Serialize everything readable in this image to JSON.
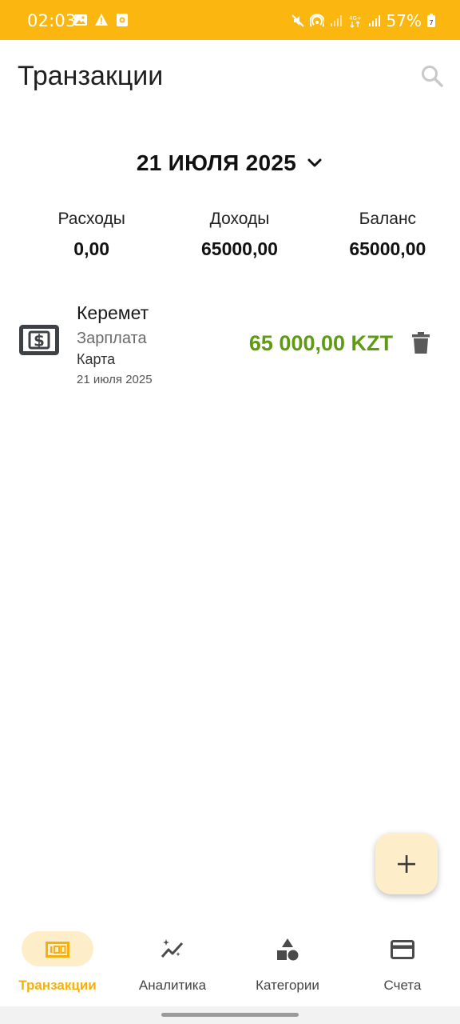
{
  "status_bar": {
    "time": "02:03",
    "battery": "57%",
    "bg_color": "#fbb70f",
    "icons_left": [
      "image-icon",
      "warning-icon",
      "app-notification-icon"
    ],
    "icons_right": [
      "mute-icon",
      "hotspot-icon",
      "signal-icon",
      "4g-icon",
      "signal-icon",
      "battery-icon"
    ]
  },
  "header": {
    "title": "Транзакции",
    "search_icon": "search-icon"
  },
  "date_selector": {
    "label": "21 ИЮЛЯ 2025",
    "icon": "chevron-down-icon"
  },
  "summary": {
    "expenses_label": "Расходы",
    "expenses_value": "0,00",
    "income_label": "Доходы",
    "income_value": "65000,00",
    "balance_label": "Баланс",
    "balance_value": "65000,00"
  },
  "transactions": [
    {
      "icon": "money-icon",
      "name": "Керемет",
      "category": "Зарплата",
      "account": "Карта",
      "date": "21 июля 2025",
      "amount": "65 000,00 KZT",
      "amount_color": "#5e9b12",
      "delete_icon": "trash-icon"
    }
  ],
  "fab": {
    "icon": "plus-icon"
  },
  "bottom_nav": {
    "active_color": "#f4b011",
    "items": [
      {
        "label": "Транзакции",
        "icon": "banknote-icon",
        "active": true
      },
      {
        "label": "Аналитика",
        "icon": "sparkle-chart-icon",
        "active": false
      },
      {
        "label": "Категории",
        "icon": "shapes-icon",
        "active": false
      },
      {
        "label": "Счета",
        "icon": "credit-card-icon",
        "active": false
      }
    ]
  }
}
